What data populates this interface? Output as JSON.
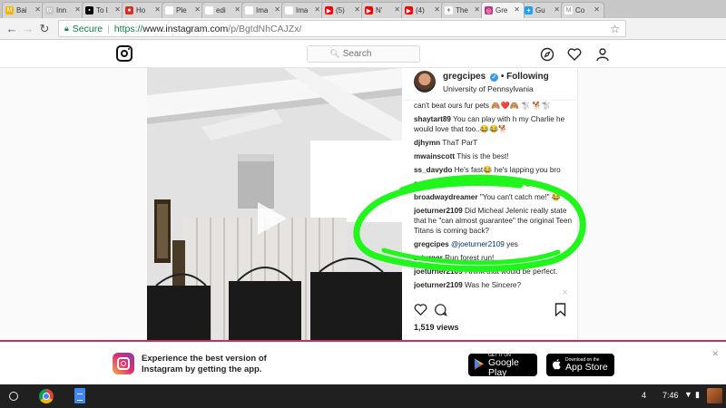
{
  "browser": {
    "tabs": [
      {
        "label": "Bai",
        "fav_color": "#f4b400",
        "fav_glyph": "M"
      },
      {
        "label": "Inn",
        "fav_color": "#c8c8c8",
        "fav_glyph": "tv"
      },
      {
        "label": "To I",
        "fav_color": "#000000",
        "fav_glyph": "▪"
      },
      {
        "label": "Ho",
        "fav_color": "#d93025",
        "fav_glyph": "●"
      },
      {
        "label": "Ple",
        "fav_color": "#ffffff",
        "fav_glyph": ""
      },
      {
        "label": "edi",
        "fav_color": "#ffffff",
        "fav_glyph": ""
      },
      {
        "label": "Ima",
        "fav_color": "#ffffff",
        "fav_glyph": ""
      },
      {
        "label": "Ima",
        "fav_color": "#ffffff",
        "fav_glyph": ""
      },
      {
        "label": "(5)",
        "fav_color": "#ff0000",
        "fav_glyph": "▶"
      },
      {
        "label": "N'",
        "fav_color": "#ff0000",
        "fav_glyph": "▶"
      },
      {
        "label": "(4)",
        "fav_color": "#ff0000",
        "fav_glyph": "▶"
      },
      {
        "label": "The",
        "fav_color": "#ffffff",
        "fav_glyph": "♦"
      },
      {
        "label": "Gre",
        "fav_color": "#c13584",
        "fav_glyph": "◎"
      },
      {
        "label": "Gu",
        "fav_color": "#1da1f2",
        "fav_glyph": "✦"
      },
      {
        "label": "Co",
        "fav_color": "#ffffff",
        "fav_glyph": "M"
      }
    ],
    "active_tab_index": 12,
    "secure_label": "Secure",
    "url_scheme": "https://",
    "url_host": "www.instagram.com",
    "url_path": "/p/BgtdNhCAJZx/"
  },
  "instagram": {
    "search_placeholder": "Search",
    "post": {
      "username": "gregcipes",
      "follow_label": "Following",
      "location": "University of Pennsylvania",
      "comments": [
        {
          "user": "",
          "text": "can't beat ours fur pets 🙈❤️🙈 🐩 🐕🐩"
        },
        {
          "user": "shaytart89",
          "text": "You can play with h my Charlie he would love that too..😂😂🐕"
        },
        {
          "user": "djhymn",
          "text": "ThaT ParT"
        },
        {
          "user": "mwainscott",
          "text": "This is the best!"
        },
        {
          "user": "ss_davydo",
          "text": "He's fast😂 he's lapping you bro"
        },
        {
          "user": "embeessaara",
          "text": "So sweet 😻💚💚💚"
        },
        {
          "user": "broadwaydreamer",
          "text": "\"You can't catch me!\" 😂"
        },
        {
          "user": "joeturner2109",
          "text": "Did Micheal Jelenic really state that he \"can almost guarantee\" the original Teen Titans is coming back?"
        },
        {
          "user": "gregcipes",
          "mention": "@joeturner2109",
          "text": "yes"
        },
        {
          "user": "zzturner",
          "text": "Run forest run!"
        },
        {
          "user": "joeturner2109",
          "text": "I think that would be perfect."
        },
        {
          "user": "joeturner2109",
          "text": "Was he Sincere?"
        }
      ],
      "views": "1,519 views"
    }
  },
  "app_banner": {
    "text": "Experience the best version of Instagram by getting the app.",
    "google_small": "GET IT ON",
    "google_big": "Google Play",
    "apple_small": "Download on the",
    "apple_big": "App Store"
  },
  "shelf": {
    "notification_count": "4",
    "time": "7:46"
  },
  "colors": {
    "annotation_green": "#20f51c",
    "banner_border": "#c9305d",
    "verified": "#3897f0"
  }
}
